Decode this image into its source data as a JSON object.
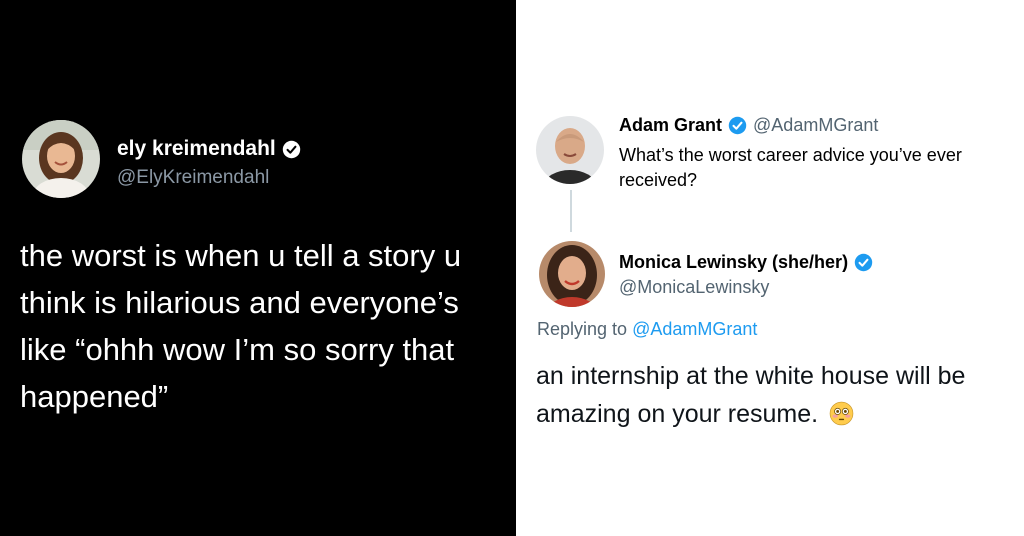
{
  "left_tweet": {
    "author_name": "ely kreimendahl",
    "author_handle": "@ElyKreimendahl",
    "text": "the worst is when u tell a story u think is hilarious and everyone’s like “ohhh wow I’m so sorry that happened”"
  },
  "right_thread": {
    "original": {
      "author_name": "Adam Grant",
      "author_handle": "@AdamMGrant",
      "text": "What’s the worst career advice you’ve ever received?"
    },
    "reply": {
      "author_name": "Monica Lewinsky (she/her)",
      "author_handle": "@MonicaLewinsky",
      "replying_to_prefix": "Replying to",
      "replying_to_handle": "@AdamMGrant",
      "text": "an internship at the white house will be amazing on your resume.",
      "emoji": "flushed-face-emoji"
    }
  },
  "colors": {
    "verified_blue": "#1d9bf0",
    "left_background": "#000000",
    "right_background": "#ffffff",
    "muted_text": "#536471"
  }
}
